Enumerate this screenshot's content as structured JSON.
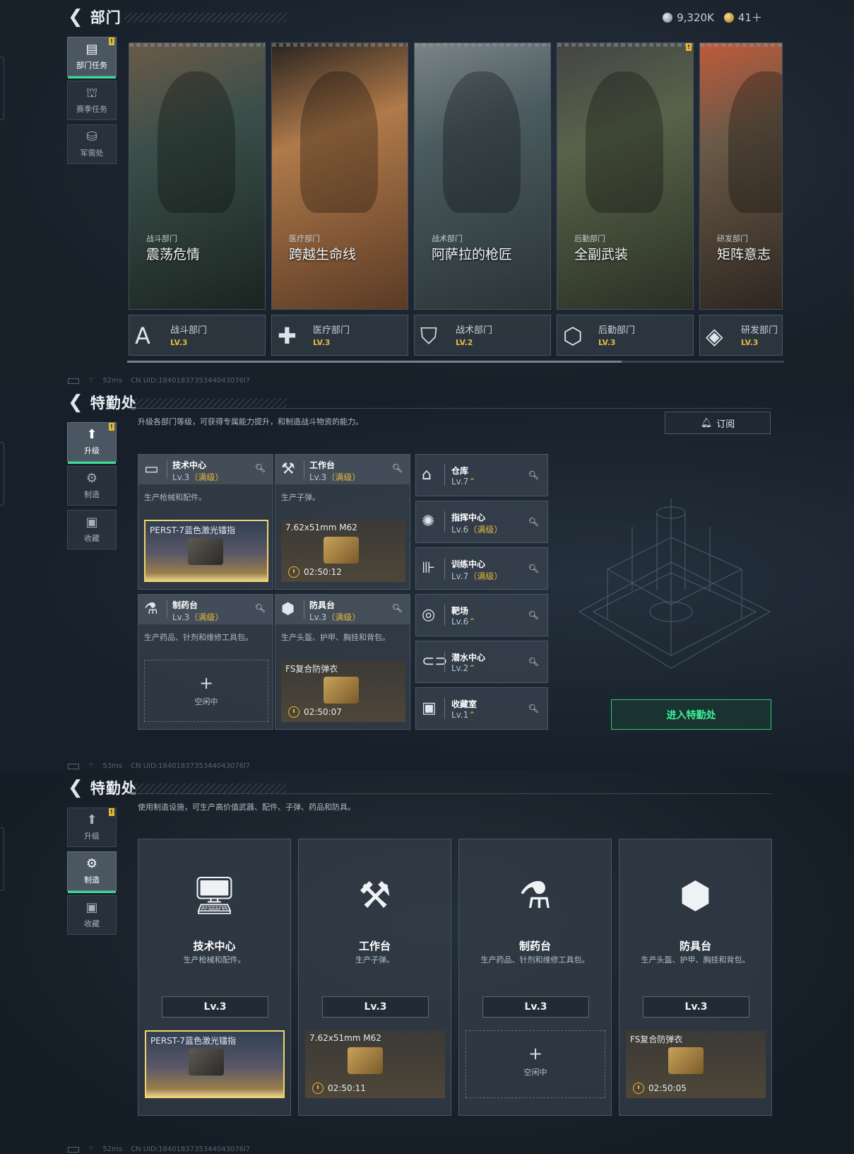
{
  "screen1": {
    "title": "部门",
    "currency": {
      "silver": "9,320K",
      "gold": "41＋"
    },
    "nav": [
      {
        "label": "部门任务",
        "icon": "clipboard-icon",
        "glyph": "▤",
        "active": true,
        "badge": "!"
      },
      {
        "label": "赛季任务",
        "icon": "season-icon",
        "glyph": "⛫",
        "active": false
      },
      {
        "label": "军需处",
        "icon": "supply-icon",
        "glyph": "⛁",
        "active": false
      }
    ],
    "departments": [
      {
        "sub": "战斗部门",
        "name": "震荡危情",
        "foot_name": "战斗部门",
        "level": "LV.3",
        "glyph": "A",
        "colors": [
          "#3b4f4a",
          "#1a2420",
          "#6b5a48"
        ]
      },
      {
        "sub": "医疗部门",
        "name": "跨越生命线",
        "foot_name": "医疗部门",
        "level": "LV.3",
        "glyph": "✚",
        "colors": [
          "#b07a4a",
          "#5a3a25",
          "#2a2420"
        ]
      },
      {
        "sub": "战术部门",
        "name": "阿萨拉的枪匠",
        "foot_name": "战术部门",
        "level": "LV.2",
        "glyph": "⛉",
        "colors": [
          "#4a5a5e",
          "#2a3436",
          "#7a8486"
        ]
      },
      {
        "sub": "后勤部门",
        "name": "全副武装",
        "foot_name": "后勤部门",
        "level": "LV.3",
        "glyph": "⬡",
        "colors": [
          "#58634a",
          "#2a3024",
          "#444"
        ],
        "badge": "!"
      },
      {
        "sub": "研发部门",
        "name": "矩阵意志",
        "foot_name": "研发部门",
        "level": "LV.3",
        "glyph": "◈",
        "colors": [
          "#6a5a48",
          "#2e2620",
          "#c05a3a"
        ]
      }
    ],
    "status": {
      "ping": "52ms",
      "uid": "CN UID:1840183735344043076l7"
    }
  },
  "screen2": {
    "title": "特勤处",
    "desc": "升级各部门等级，可获得专属能力提升，和制造战斗物资的能力。",
    "subscribe": "订阅",
    "nav": [
      {
        "label": "升级",
        "icon": "upgrade-icon",
        "glyph": "⬆",
        "active": true,
        "badge": "!"
      },
      {
        "label": "制造",
        "icon": "craft-icon",
        "glyph": "⚙",
        "active": false
      },
      {
        "label": "收藏",
        "icon": "collection-icon",
        "glyph": "▣",
        "active": false
      }
    ],
    "facilities": [
      {
        "name": "技术中心",
        "lv": "Lv.3",
        "max": "（满级）",
        "desc": "生产枪械和配件。",
        "glyph": "▭",
        "slot": {
          "type": "sel",
          "item": "PERST-7蓝色激光镭指",
          "time": ""
        }
      },
      {
        "name": "工作台",
        "lv": "Lv.3",
        "max": "（满级）",
        "desc": "生产子弹。",
        "glyph": "⚒",
        "slot": {
          "type": "brown",
          "item": "7.62x51mm M62",
          "time": "02:50:12"
        }
      },
      {
        "name": "制药台",
        "lv": "Lv.3",
        "max": "（满级）",
        "desc": "生产药品、针剂和维修工具包。",
        "glyph": "⚗",
        "slot": {
          "type": "empty",
          "plus": "+",
          "idle": "空闲中"
        }
      },
      {
        "name": "防具台",
        "lv": "Lv.3",
        "max": "（满级）",
        "desc": "生产头盔、护甲、胸挂和背包。",
        "glyph": "⬢",
        "slot": {
          "type": "brown",
          "item": "FS复合防弹衣",
          "time": "02:50:07"
        }
      }
    ],
    "rooms": [
      {
        "name": "仓库",
        "lv": "Lv.7",
        "tag": "⌃",
        "glyph": "⌂"
      },
      {
        "name": "指挥中心",
        "lv": "Lv.6",
        "tag": "（满级）",
        "glyph": "✺"
      },
      {
        "name": "训练中心",
        "lv": "Lv.7",
        "tag": "（满级）",
        "glyph": "⊪"
      },
      {
        "name": "靶场",
        "lv": "Lv.6",
        "tag": "⌃",
        "glyph": "◎"
      },
      {
        "name": "潜水中心",
        "lv": "Lv.2",
        "tag": "⌃",
        "glyph": "⊂⊃"
      },
      {
        "name": "收藏室",
        "lv": "Lv.1",
        "tag": "⌃",
        "glyph": "▣"
      }
    ],
    "enter": "进入特勤处",
    "status": {
      "ping": "53ms",
      "uid": "CN UID:1840183735344043076l7"
    }
  },
  "screen3": {
    "title": "特勤处",
    "desc": "使用制造设施，可生产高价值武器、配件、子弹、药品和防具。",
    "nav": [
      {
        "label": "升级",
        "icon": "upgrade-icon",
        "glyph": "⬆",
        "active": false,
        "badge": "!"
      },
      {
        "label": "制造",
        "icon": "craft-icon",
        "glyph": "⚙",
        "active": true
      },
      {
        "label": "收藏",
        "icon": "collection-icon",
        "glyph": "▣",
        "active": false
      }
    ],
    "cards": [
      {
        "name": "技术中心",
        "desc": "生产枪械和配件。",
        "lv": "Lv.3",
        "glyph": "🖥",
        "slot": {
          "type": "sel",
          "item": "PERST-7蓝色激光镭指",
          "time": ""
        }
      },
      {
        "name": "工作台",
        "desc": "生产子弹。",
        "lv": "Lv.3",
        "glyph": "⚒",
        "slot": {
          "type": "brown",
          "item": "7.62x51mm M62",
          "time": "02:50:11"
        }
      },
      {
        "name": "制药台",
        "desc": "生产药品、针剂和维修工具包。",
        "lv": "Lv.3",
        "glyph": "⚗",
        "slot": {
          "type": "empty",
          "plus": "+",
          "idle": "空闲中"
        }
      },
      {
        "name": "防具台",
        "desc": "生产头盔、护甲、胸挂和背包。",
        "lv": "Lv.3",
        "glyph": "⬢",
        "slot": {
          "type": "brown",
          "item": "FS复合防弹衣",
          "time": "02:50:05"
        }
      }
    ],
    "status": {
      "ping": "52ms",
      "uid": "CN UID:1840183735344043076l7"
    }
  }
}
